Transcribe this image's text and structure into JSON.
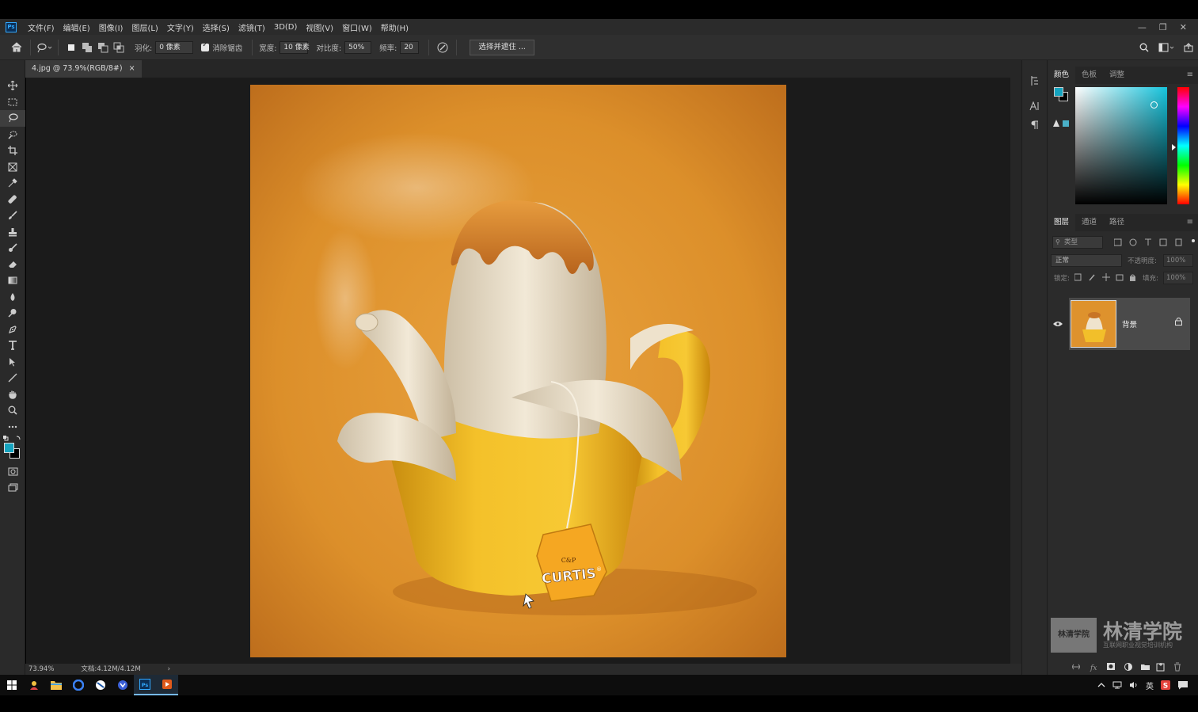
{
  "menubar": {
    "app_icon_label": "Ps",
    "items": [
      "文件(F)",
      "编辑(E)",
      "图像(I)",
      "图层(L)",
      "文字(Y)",
      "选择(S)",
      "滤镜(T)",
      "3D(D)",
      "视图(V)",
      "窗口(W)",
      "帮助(H)"
    ],
    "window_controls": [
      "—",
      "❐",
      "✕"
    ]
  },
  "options": {
    "feather_label": "羽化:",
    "feather_value": "0 像素",
    "antialias_label": "消除锯齿",
    "width_label": "宽度:",
    "width_value": "10 像素",
    "contrast_label": "对比度:",
    "contrast_value": "50%",
    "frequency_label": "频率:",
    "frequency_value": "20",
    "select_mask_button": "选择并遮住 ..."
  },
  "document": {
    "tab_title": "4.jpg @ 73.9%(RGB/8#)",
    "tab_close": "×",
    "zoom": "73.94%",
    "doc_info": "文档:4.12M/4.12M",
    "status_arrow": "›"
  },
  "artwork": {
    "brand_top": "C&P",
    "brand_name": "CURTIS",
    "brand_reg": "®"
  },
  "color_panel": {
    "tabs": [
      "颜色",
      "色板",
      "调整"
    ],
    "foreground": "#15a4c0",
    "background": "#000000"
  },
  "layers_panel": {
    "tabs": [
      "图层",
      "通道",
      "路径"
    ],
    "filter_placeholder": "类型",
    "blend_mode": "正常",
    "opacity_label": "不透明度:",
    "opacity_value": "100%",
    "lock_label": "锁定:",
    "fill_label": "填充:",
    "fill_value": "100%",
    "layers": [
      {
        "name": "背景"
      }
    ],
    "footer_icons": [
      "link-icon",
      "fx-icon",
      "mask-icon",
      "adjustment-icon",
      "folder-icon",
      "new-layer-icon",
      "trash-icon"
    ]
  },
  "watermark": {
    "logo_text": "林清学院",
    "title": "林清学院",
    "subtitle": "互联网职业视觉培训机构"
  },
  "taskbar": {
    "ime_label": "英"
  },
  "colors": {
    "accent": "#31a8ff",
    "canvas_bg": "#1b1b1b",
    "panel_bg": "#2b2b2b"
  }
}
